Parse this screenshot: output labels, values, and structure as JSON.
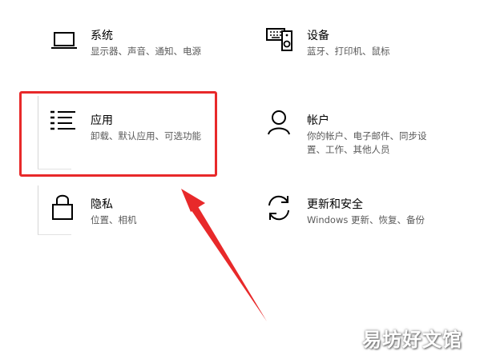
{
  "settings_tiles": [
    {
      "title": "系统",
      "desc": "显示器、声音、通知、电源",
      "icon": "laptop-icon"
    },
    {
      "title": "设备",
      "desc": "蓝牙、打印机、鼠标",
      "icon": "keyboard-speaker-icon"
    },
    {
      "title": "应用",
      "desc_lines": [
        "卸载、默认应用、可选功能"
      ],
      "icon": "app-list-icon"
    },
    {
      "title": "帐户",
      "desc_lines": [
        "你的帐户、电子邮件、同步设",
        "置、工作、其他人员"
      ],
      "icon": "person-icon"
    },
    {
      "title": "隐私",
      "desc": "位置、相机",
      "icon": "lock-icon"
    },
    {
      "title": "更新和安全",
      "desc": "Windows 更新、恢复、备份",
      "icon": "sync-arrows-icon"
    }
  ],
  "annotation": {
    "highlight_color": "#e8292a",
    "arrow_color": "#e8292a"
  },
  "watermark": "易坊好文馆"
}
